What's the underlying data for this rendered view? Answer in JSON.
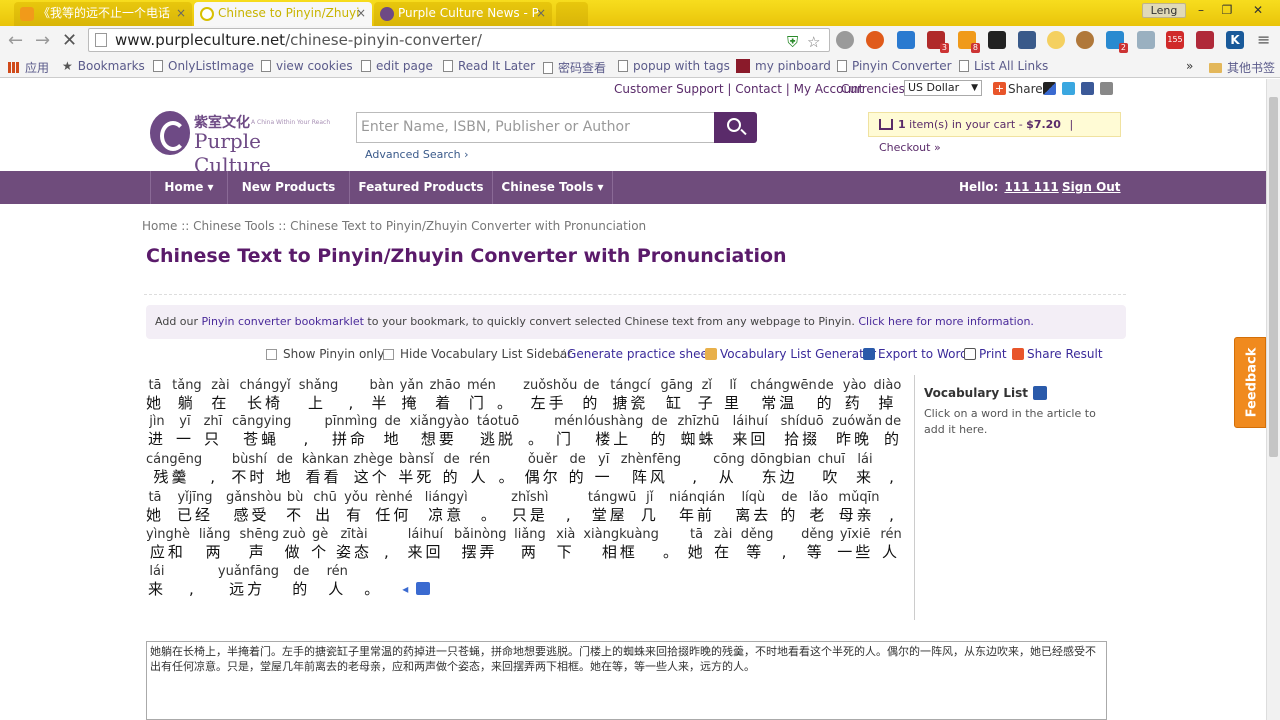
{
  "browser": {
    "tabs": [
      {
        "title": "《我等的远不止一个电话",
        "state": "inactive"
      },
      {
        "title": "Chinese to Pinyin/Zhuyi",
        "state": "active"
      },
      {
        "title": "Purple Culture News - P",
        "state": "inactive"
      }
    ],
    "window_user": "Leng",
    "url_host": "www.purpleculture.net",
    "url_path": "/chinese-pinyin-converter/",
    "bookmarks": [
      "应用",
      "Bookmarks",
      "OnlyListImage",
      "view cookies",
      "edit page",
      "Read It Later",
      "密码查看",
      "popup with tags",
      "my pinboard",
      "Pinyin Converter",
      "List All Links",
      "其他书签"
    ],
    "bookmarks_more": "»",
    "extension_badges": [
      "3",
      "8",
      "2",
      "155"
    ]
  },
  "site": {
    "top_links": [
      "Customer Support",
      "Contact",
      "My Account"
    ],
    "separator": "|",
    "currencies_label": "Currencies:",
    "currency_value": "US Dollar",
    "share_label": "Share",
    "logo_cn": "紫室文化",
    "logo_tagline": "A China Within Your Reach",
    "logo_en": "Purple Culture",
    "search_placeholder": "Enter Name, ISBN, Publisher or Author",
    "advanced_search": "Advanced Search ›",
    "cart": {
      "count": "1",
      "text": "item(s) in your cart -",
      "total": "$7.20",
      "sep": "|",
      "checkout": "Checkout »"
    },
    "nav": [
      "Home ▾",
      "New Products",
      "Featured Products",
      "Chinese Tools ▾"
    ],
    "hello_label": "Hello:",
    "user_name": "111 111",
    "sign_out": "Sign Out"
  },
  "main": {
    "breadcrumb": "Home ::  Chinese Tools ::  Chinese Text to Pinyin/Zhuyin Converter with Pronunciation",
    "title": "Chinese Text to Pinyin/Zhuyin Converter with Pronunciation",
    "notice_prefix": "Add our ",
    "notice_link1": "Pinyin converter bookmarklet",
    "notice_middle": " to your bookmark, to quickly convert selected Chinese text from any webpage to Pinyin. ",
    "notice_link2": "Click here for more information.",
    "tools": {
      "show_pinyin": "Show Pinyin only",
      "hide_vocab": "Hide Vocabulary List Sidebar",
      "practice": "Generate practice sheet",
      "vocab_gen": "Vocabulary List Generator",
      "export_word": "Export to Word",
      "print": "Print",
      "share_result": "Share Result"
    },
    "lines": [
      [
        [
          "tā",
          "她"
        ],
        [
          "tǎng",
          "躺"
        ],
        [
          "zài",
          "在"
        ],
        [
          "chángyǐ",
          "长椅"
        ],
        [
          "shǎng",
          "上"
        ],
        [
          "",
          ","
        ],
        [
          "bàn",
          "半"
        ],
        [
          "yǎn",
          "掩"
        ],
        [
          "zhāo",
          "着"
        ],
        [
          "mén",
          "门"
        ],
        [
          "",
          "。"
        ],
        [
          "zuǒshǒu",
          "左手"
        ],
        [
          "de",
          "的"
        ],
        [
          "tángcí",
          "搪瓷"
        ],
        [
          "gāng",
          "缸"
        ],
        [
          "zǐ",
          "子"
        ],
        [
          "lǐ",
          "里"
        ],
        [
          "chángwēn",
          "常温"
        ],
        [
          "de",
          "的"
        ],
        [
          "yào",
          "药"
        ],
        [
          "diào",
          "掉"
        ]
      ],
      [
        [
          "jìn",
          "进"
        ],
        [
          "yī",
          "一"
        ],
        [
          "zhī",
          "只"
        ],
        [
          "cāngying",
          "苍蝇"
        ],
        [
          "",
          ","
        ],
        [
          "pīnmìng",
          "拼命"
        ],
        [
          "de",
          "地"
        ],
        [
          "xiǎngyào",
          "想要"
        ],
        [
          "táotuō",
          "逃脱"
        ],
        [
          "",
          "。"
        ],
        [
          "mén",
          "门"
        ],
        [
          "lóushàng",
          "楼上"
        ],
        [
          "de",
          "的"
        ],
        [
          "zhīzhū",
          "蜘蛛"
        ],
        [
          "láihuí",
          "来回"
        ],
        [
          "shíduō",
          "拾掇"
        ],
        [
          "zuówǎn",
          "昨晚"
        ],
        [
          "de",
          "的"
        ]
      ],
      [
        [
          "cángēng",
          "残羹"
        ],
        [
          "",
          ","
        ],
        [
          "bùshí",
          "不时"
        ],
        [
          "de",
          "地"
        ],
        [
          "kànkan",
          "看看"
        ],
        [
          "zhège",
          "这个"
        ],
        [
          "bànsǐ",
          "半死"
        ],
        [
          "de",
          "的"
        ],
        [
          "rén",
          "人"
        ],
        [
          "",
          "。"
        ],
        [
          "ǒuěr",
          "偶尔"
        ],
        [
          "de",
          "的"
        ],
        [
          "yī",
          "一"
        ],
        [
          "zhènfēng",
          "阵风"
        ],
        [
          "",
          ","
        ],
        [
          "cōng",
          "从"
        ],
        [
          "dōngbian",
          "东边"
        ],
        [
          "chuī",
          "吹"
        ],
        [
          "lái",
          "来"
        ],
        [
          "",
          ","
        ]
      ],
      [
        [
          "tā",
          "她"
        ],
        [
          "yǐjīng",
          "已经"
        ],
        [
          "gǎnshòu",
          "感受"
        ],
        [
          "bù",
          "不"
        ],
        [
          "chū",
          "出"
        ],
        [
          "yǒu",
          "有"
        ],
        [
          "rènhé",
          "任何"
        ],
        [
          "liángyì",
          "凉意"
        ],
        [
          "",
          "。"
        ],
        [
          "zhǐshì",
          "只是"
        ],
        [
          "",
          ","
        ],
        [
          "tángwū",
          "堂屋"
        ],
        [
          "jǐ",
          "几"
        ],
        [
          "niánqián",
          "年前"
        ],
        [
          "líqù",
          "离去"
        ],
        [
          "de",
          "的"
        ],
        [
          "lǎo",
          "老"
        ],
        [
          "mǔqīn",
          "母亲"
        ],
        [
          "",
          ","
        ]
      ],
      [
        [
          "yìnghè",
          "应和"
        ],
        [
          "liǎng",
          "两"
        ],
        [
          "shēng",
          "声"
        ],
        [
          "zuò",
          "做"
        ],
        [
          "gè",
          "个"
        ],
        [
          "zītài",
          "姿态"
        ],
        [
          "",
          ","
        ],
        [
          "láihuí",
          "来回"
        ],
        [
          "bǎinòng",
          "摆弄"
        ],
        [
          "liǎng",
          "两"
        ],
        [
          "xià",
          "下"
        ],
        [
          "xiàngkuàng",
          "相框"
        ],
        [
          "",
          "。"
        ],
        [
          "tā",
          "她"
        ],
        [
          "zài",
          "在"
        ],
        [
          "děng",
          "等"
        ],
        [
          "",
          ","
        ],
        [
          "děng",
          "等"
        ],
        [
          "yīxiē",
          "一些"
        ],
        [
          "rén",
          "人"
        ]
      ],
      [
        [
          "lái",
          "来"
        ],
        [
          "",
          ","
        ],
        [
          "yuǎnfāng",
          "远方"
        ],
        [
          "de",
          "的"
        ],
        [
          "rén",
          "人"
        ],
        [
          "",
          "。"
        ]
      ]
    ],
    "vocab_title": "Vocabulary List",
    "vocab_hint": "Click on a word in the article to add it here.",
    "textarea": "她躺在长椅上，半掩着门。左手的搪瓷缸子里常温的药掉进一只苍蝇，拼命地想要逃脱。门楼上的蜘蛛来回拾掇昨晚的残羹，不时地看看这个半死的人。偶尔的一阵风，从东边吹来，她已经感受不出有任何凉意。只是，堂屋几年前离去的老母亲，应和两声做个姿态，来回摆弄两下相框。她在等，等一些人来，远方的人。",
    "feedback": "Feedback"
  },
  "colors": {
    "brand_purple": "#6f4c7c",
    "title_purple": "#5a1a6a",
    "tab_yellow": "#f0cf14",
    "feedback_orange": "#f08a1e"
  }
}
